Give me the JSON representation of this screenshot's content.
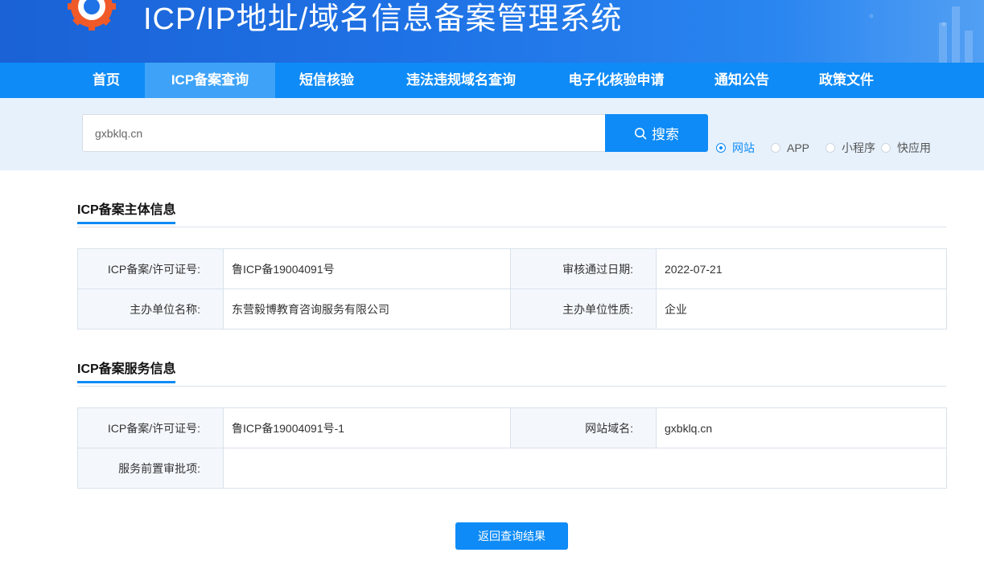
{
  "header": {
    "title": "ICP/IP地址/域名信息备案管理系统"
  },
  "nav": {
    "items": [
      {
        "label": "首页"
      },
      {
        "label": "ICP备案查询"
      },
      {
        "label": "短信核验"
      },
      {
        "label": "违法违规域名查询"
      },
      {
        "label": "电子化核验申请"
      },
      {
        "label": "通知公告"
      },
      {
        "label": "政策文件"
      }
    ],
    "active_index": 1
  },
  "search": {
    "value": "gxbklq.cn",
    "button_label": "搜索",
    "types": [
      {
        "label": "网站",
        "checked": true
      },
      {
        "label": "APP",
        "checked": false
      },
      {
        "label": "小程序",
        "checked": false
      },
      {
        "label": "快应用",
        "checked": false
      }
    ]
  },
  "subject_section": {
    "title": "ICP备案主体信息",
    "rows": [
      {
        "label1": "ICP备案/许可证号:",
        "value1": "鲁ICP备19004091号",
        "label2": "审核通过日期:",
        "value2": "2022-07-21"
      },
      {
        "label1": "主办单位名称:",
        "value1": "东营毅博教育咨询服务有限公司",
        "label2": "主办单位性质:",
        "value2": "企业"
      }
    ]
  },
  "service_section": {
    "title": "ICP备案服务信息",
    "row1": {
      "label1": "ICP备案/许可证号:",
      "value1": "鲁ICP备19004091号-1",
      "label2": "网站域名:",
      "value2": "gxbklq.cn"
    },
    "row2": {
      "label": "服务前置审批项:",
      "value": ""
    }
  },
  "footer": {
    "back_button_label": "返回查询结果"
  },
  "colors": {
    "primary": "#0e8bf6",
    "banner": "#1f73e6",
    "search_band": "#e7f1fc",
    "label_bg": "#f4f8fc"
  }
}
